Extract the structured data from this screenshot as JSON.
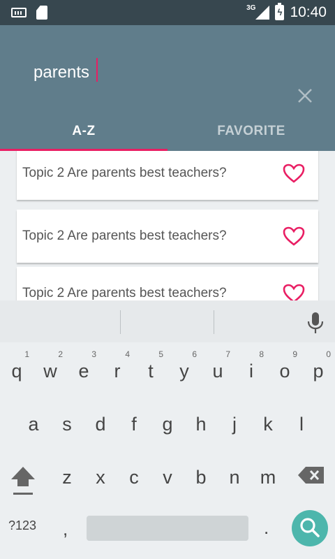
{
  "status_bar": {
    "network_type": "3G",
    "time": "10:40",
    "icons": [
      "keyboard-icon",
      "sd-card-icon",
      "signal-icon",
      "battery-charging-icon"
    ]
  },
  "search": {
    "value": "parents",
    "clear_icon": "close-icon"
  },
  "tabs": [
    {
      "label": "A-Z",
      "active": true
    },
    {
      "label": "FAVORITE",
      "active": false
    }
  ],
  "results": [
    {
      "title": "Topic 2 Are parents best teachers?",
      "icon": "heart-outline-icon"
    },
    {
      "title": "Topic 2 Are parents best teachers?",
      "icon": "heart-outline-icon"
    },
    {
      "title": "Topic 2 Are parents best teachers?",
      "icon": "heart-outline-icon"
    }
  ],
  "keyboard": {
    "row1": [
      {
        "ch": "q",
        "num": "1"
      },
      {
        "ch": "w",
        "num": "2"
      },
      {
        "ch": "e",
        "num": "3"
      },
      {
        "ch": "r",
        "num": "4"
      },
      {
        "ch": "t",
        "num": "5"
      },
      {
        "ch": "y",
        "num": "6"
      },
      {
        "ch": "u",
        "num": "7"
      },
      {
        "ch": "i",
        "num": "8"
      },
      {
        "ch": "o",
        "num": "9"
      },
      {
        "ch": "p",
        "num": "0"
      }
    ],
    "row2": [
      "a",
      "s",
      "d",
      "f",
      "g",
      "h",
      "j",
      "k",
      "l"
    ],
    "row3": [
      "z",
      "x",
      "c",
      "v",
      "b",
      "n",
      "m"
    ],
    "symbols_label": "?123",
    "comma": ",",
    "period": ".",
    "colors": {
      "accent": "#e91e63",
      "search_key": "#4db6ac",
      "app_bar": "#607d8b",
      "status_bar": "#37474f"
    }
  }
}
